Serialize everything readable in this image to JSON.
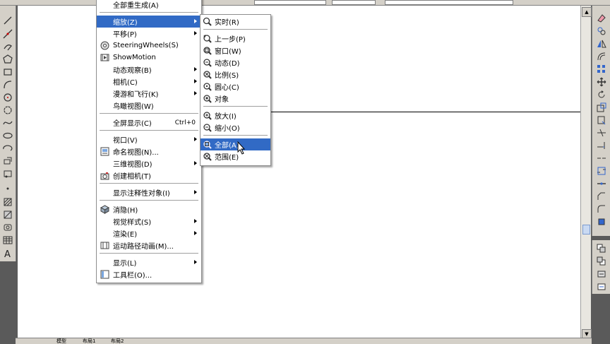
{
  "colors": {
    "highlight": "#316ac5",
    "canvas": "#ffffff",
    "chrome": "#d4d0c8",
    "frame": "#5a5a5a"
  },
  "main_menu": {
    "items": [
      {
        "label": "全部重生成(A)",
        "icon": "none",
        "has_submenu": false,
        "shortcut": "",
        "highlighted": false
      },
      {
        "label": "缩放(Z)",
        "icon": "none",
        "has_submenu": true,
        "shortcut": "",
        "highlighted": true
      },
      {
        "label": "平移(P)",
        "icon": "none",
        "has_submenu": true,
        "shortcut": "",
        "highlighted": false
      },
      {
        "label": "SteeringWheels(S)",
        "icon": "steering-wheel-icon",
        "has_submenu": false,
        "shortcut": "",
        "highlighted": false
      },
      {
        "label": "ShowMotion",
        "icon": "showmotion-icon",
        "has_submenu": false,
        "shortcut": "",
        "highlighted": false
      },
      {
        "label": "动态观察(B)",
        "icon": "none",
        "has_submenu": true,
        "shortcut": "",
        "highlighted": false
      },
      {
        "label": "相机(C)",
        "icon": "none",
        "has_submenu": true,
        "shortcut": "",
        "highlighted": false
      },
      {
        "label": "漫游和飞行(K)",
        "icon": "none",
        "has_submenu": true,
        "shortcut": "",
        "highlighted": false
      },
      {
        "label": "鸟瞰视图(W)",
        "icon": "none",
        "has_submenu": false,
        "shortcut": "",
        "highlighted": false
      },
      {
        "label": "全屏显示(C)",
        "icon": "none",
        "has_submenu": false,
        "shortcut": "Ctrl+0",
        "highlighted": false
      },
      {
        "label": "视口(V)",
        "icon": "none",
        "has_submenu": true,
        "shortcut": "",
        "highlighted": false
      },
      {
        "label": "命名视图(N)...",
        "icon": "named-view-icon",
        "has_submenu": false,
        "shortcut": "",
        "highlighted": false
      },
      {
        "label": "三维视图(D)",
        "icon": "none",
        "has_submenu": true,
        "shortcut": "",
        "highlighted": false
      },
      {
        "label": "创建相机(T)",
        "icon": "camera-icon",
        "has_submenu": false,
        "shortcut": "",
        "highlighted": false
      },
      {
        "label": "显示注释性对象(I)",
        "icon": "none",
        "has_submenu": true,
        "shortcut": "",
        "highlighted": false
      },
      {
        "label": "消隐(H)",
        "icon": "hide-icon",
        "has_submenu": false,
        "shortcut": "",
        "highlighted": false
      },
      {
        "label": "视觉样式(S)",
        "icon": "none",
        "has_submenu": true,
        "shortcut": "",
        "highlighted": false
      },
      {
        "label": "渲染(E)",
        "icon": "none",
        "has_submenu": true,
        "shortcut": "",
        "highlighted": false
      },
      {
        "label": "运动路径动画(M)...",
        "icon": "motion-path-icon",
        "has_submenu": false,
        "shortcut": "",
        "highlighted": false
      },
      {
        "label": "显示(L)",
        "icon": "none",
        "has_submenu": true,
        "shortcut": "",
        "highlighted": false
      },
      {
        "label": "工具栏(O)...",
        "icon": "toolbar-icon",
        "has_submenu": false,
        "shortcut": "",
        "highlighted": false
      }
    ]
  },
  "zoom_submenu": {
    "items": [
      {
        "label": "实时(R)",
        "icon": "zoom-realtime-icon",
        "highlighted": false
      },
      {
        "label": "上一步(P)",
        "icon": "zoom-previous-icon",
        "highlighted": false
      },
      {
        "label": "窗口(W)",
        "icon": "zoom-window-icon",
        "highlighted": false
      },
      {
        "label": "动态(D)",
        "icon": "zoom-dynamic-icon",
        "highlighted": false
      },
      {
        "label": "比例(S)",
        "icon": "zoom-scale-icon",
        "highlighted": false
      },
      {
        "label": "圆心(C)",
        "icon": "zoom-center-icon",
        "highlighted": false
      },
      {
        "label": "对象",
        "icon": "zoom-object-icon",
        "highlighted": false
      },
      {
        "label": "放大(I)",
        "icon": "zoom-in-icon",
        "highlighted": false
      },
      {
        "label": "缩小(O)",
        "icon": "zoom-out-icon",
        "highlighted": false
      },
      {
        "label": "全部(A)",
        "icon": "zoom-all-icon",
        "highlighted": true
      },
      {
        "label": "范围(E)",
        "icon": "zoom-extents-icon",
        "highlighted": false
      }
    ]
  },
  "layout_tabs": [
    "模型",
    "布局1",
    "布局2"
  ]
}
